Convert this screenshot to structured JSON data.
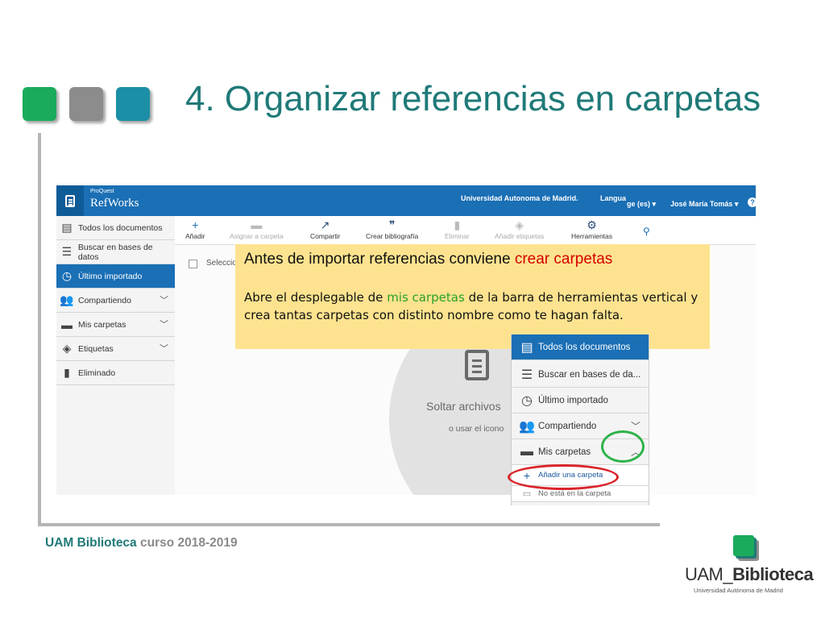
{
  "slide": {
    "title": "4. Organizar referencias en carpetas",
    "footer_org": "UAM Biblioteca",
    "footer_course": " curso 2018-2019",
    "logo_prefix": "UAM_",
    "logo_name": "Biblioteca",
    "logo_sub": "Universidad Autónoma de Madrid",
    "colors": {
      "accent": "#1f7a78",
      "green": "#1aab5c",
      "gray": "#8c8c8c",
      "teal": "#1a8fa6"
    }
  },
  "app": {
    "brand_small": "ProQuest",
    "brand": "RefWorks",
    "university": "Universidad Autonoma de Madrid.",
    "language_partial": "Langua",
    "language_tail": "ge (es) ▾",
    "user": "José María Tomás ▾",
    "help": "?",
    "sidebar": [
      {
        "label": "Todos los documentos",
        "icon": "document-icon"
      },
      {
        "label": "Buscar en bases de datos",
        "icon": "database-icon"
      },
      {
        "label": "Último importado",
        "icon": "clock-icon"
      },
      {
        "label": "Compartiendo",
        "icon": "users-icon"
      },
      {
        "label": "Mis carpetas",
        "icon": "folder-icon"
      },
      {
        "label": "Etiquetas",
        "icon": "tag-icon"
      },
      {
        "label": "Eliminado",
        "icon": "trash-icon"
      }
    ],
    "toolbar": [
      {
        "label": "Añadir",
        "icon": "plus-icon"
      },
      {
        "label": "Asignar a carpeta",
        "icon": "folder-icon"
      },
      {
        "label": "Compartir",
        "icon": "share-icon"
      },
      {
        "label": "Crear bibliografía",
        "icon": "quote-icon"
      },
      {
        "label": "Eliminar",
        "icon": "trash-icon"
      },
      {
        "label": "Añadir etiquetas",
        "icon": "tag-icon"
      },
      {
        "label": "Herramientas",
        "icon": "gear-icon"
      }
    ],
    "select_partial": "Seleccio",
    "drop_title": "Soltar archivos",
    "drop_sub": "o usar el icono"
  },
  "callout": {
    "title_prefix": "Antes de importar referencias conviene ",
    "title_highlight": "crear carpetas",
    "body_1": "Abre el desplegable de ",
    "body_highlight": "mis carpetas",
    "body_2": " de la barra de herramientas vertical y crea tantas carpetas con distinto nombre como te hagan falta."
  },
  "zoom": {
    "items": [
      {
        "label": "Todos los documentos"
      },
      {
        "label": "Buscar en bases de da..."
      },
      {
        "label": "Último importado"
      },
      {
        "label": "Compartiendo"
      },
      {
        "label": "Mis carpetas"
      }
    ],
    "add_folder": "Añadir una carpeta",
    "not_in_folder": "No está en la carpeta"
  }
}
